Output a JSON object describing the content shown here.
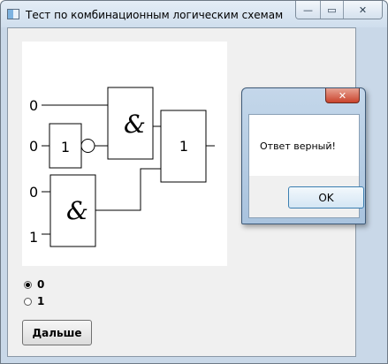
{
  "window": {
    "title": "Тест по комбинационным логическим схемам",
    "minimize": "—",
    "maximize": "▭",
    "close": "✕"
  },
  "circuit": {
    "inputs": [
      "0",
      "0",
      "0",
      "1"
    ],
    "gate_and_top": "&",
    "gate_not": "1",
    "gate_and_bottom": "&",
    "gate_or_output": "1"
  },
  "answers": {
    "options": [
      "0",
      "1"
    ],
    "selected": "0"
  },
  "next_button": "Дальше",
  "message_box": {
    "close": "✕",
    "text": "Ответ верный!",
    "ok": "OK"
  }
}
